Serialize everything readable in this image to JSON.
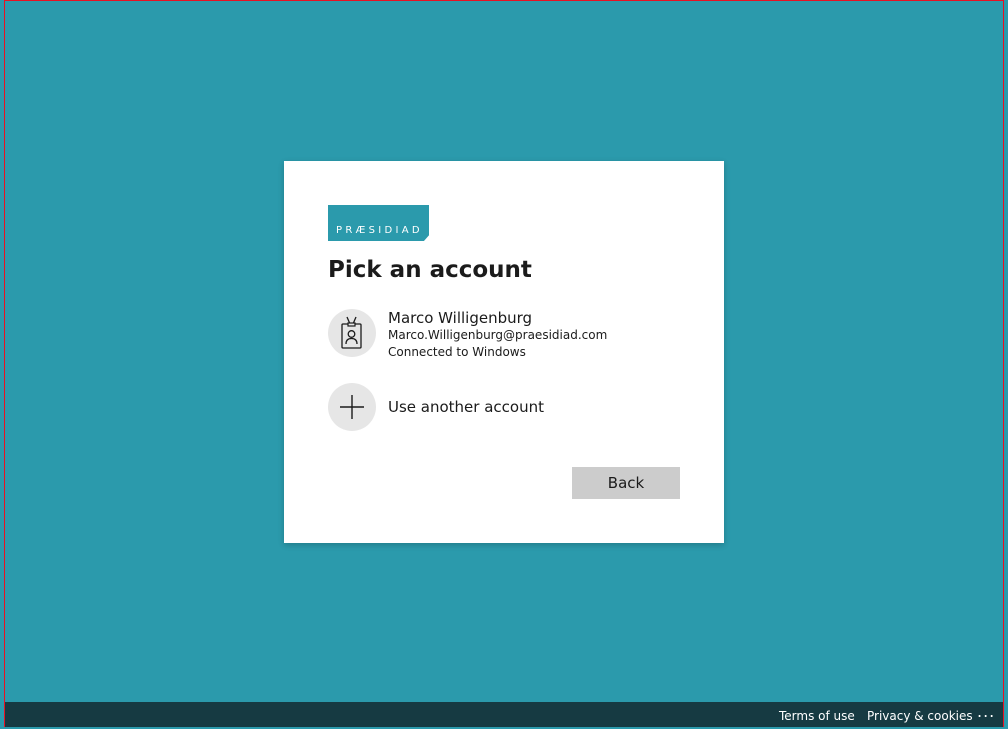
{
  "colors": {
    "background": "#2b9aac",
    "card": "#ffffff",
    "footer": "#163a42",
    "button": "#cccccc",
    "avatar": "#e6e6e6",
    "frame_border": "#e81123"
  },
  "brand": {
    "logo_text": "PRÆSIDIAD"
  },
  "dialog": {
    "title": "Pick an account",
    "accounts": [
      {
        "icon": "badge-person-icon",
        "name": "Marco Willigenburg",
        "email": "Marco.Willigenburg@praesidiad.com",
        "status": "Connected to Windows"
      }
    ],
    "other_account": {
      "icon": "plus-icon",
      "label": "Use another account"
    },
    "back_label": "Back"
  },
  "footer": {
    "terms_label": "Terms of use",
    "privacy_label": "Privacy & cookies",
    "more_label": "..."
  }
}
